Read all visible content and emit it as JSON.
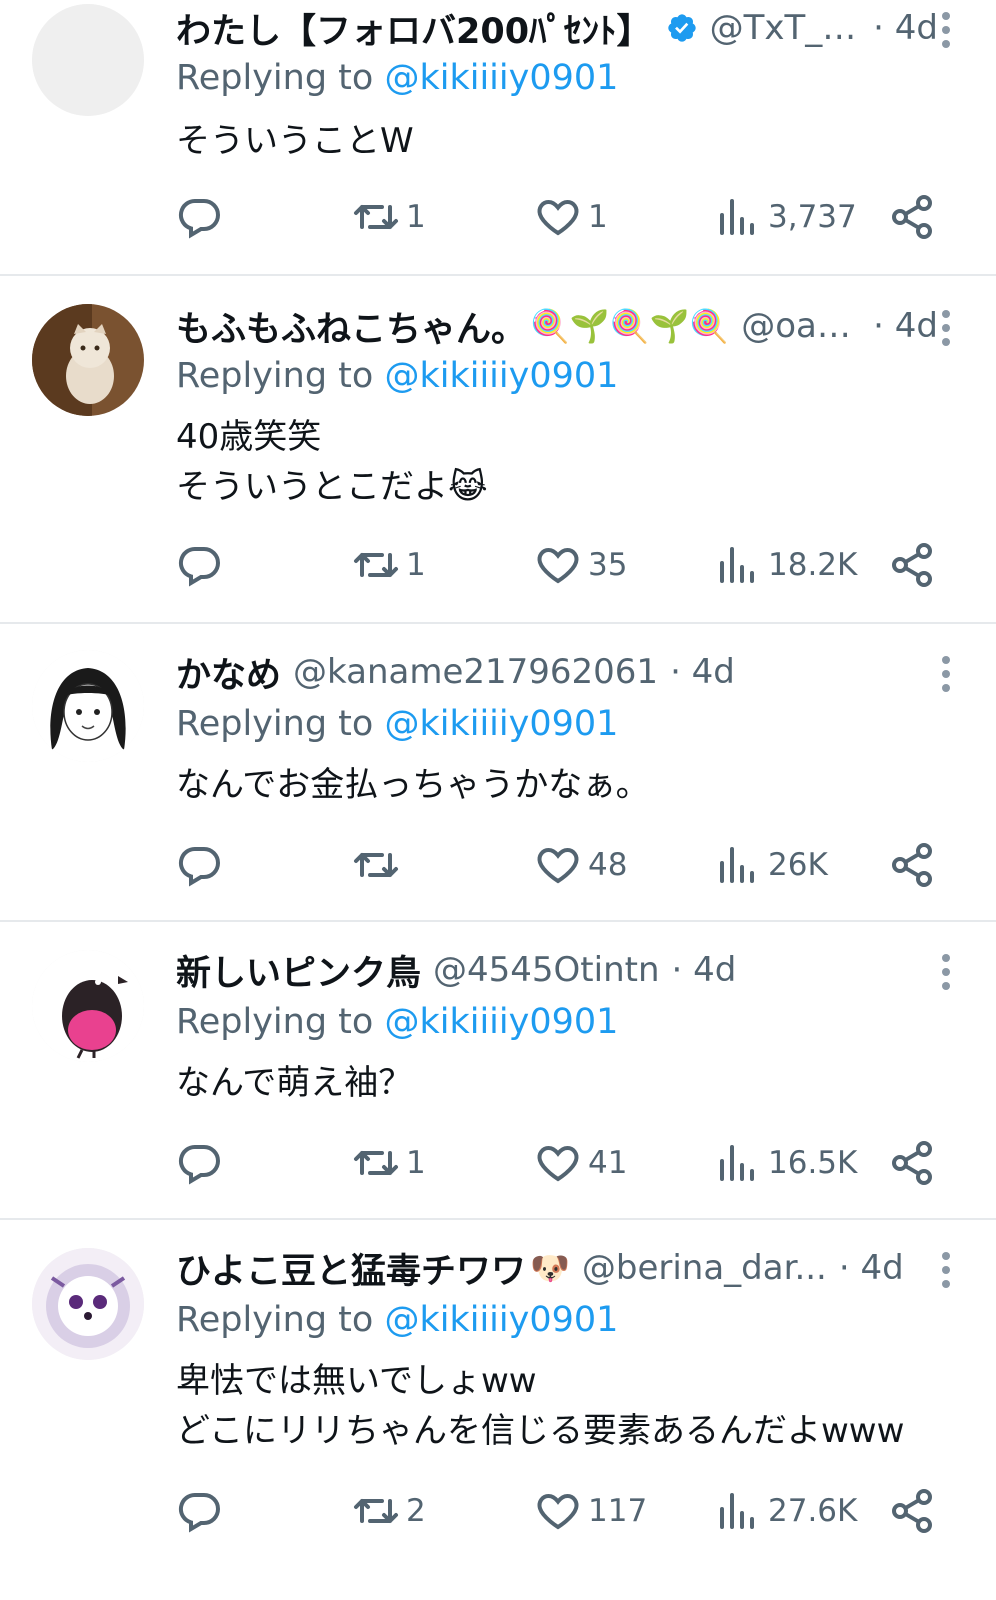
{
  "replying_label": "Replying to",
  "tweets": [
    {
      "name": "わたし【フォロバ200ﾊﾟｾﾝﾄ】",
      "handle": "@TxT_o...",
      "time": "· 4d",
      "verified": true,
      "reply_to": "@kikiiiiy0901",
      "text": "そういうことW",
      "retweets": "1",
      "likes": "1",
      "views": "3,737",
      "avatar": "blank"
    },
    {
      "name": "もふもふねこちゃん。",
      "name_emoji": "🍭🌱🍭🌱🍭",
      "handle": "@oasis_l...",
      "time": "· 4d",
      "reply_to": "@kikiiiiy0901",
      "text": "40歳笑笑\nそういうとこだよ😹",
      "retweets": "1",
      "likes": "35",
      "views": "18.2K",
      "avatar": "cat"
    },
    {
      "name": "かなめ",
      "handle": "@kaname217962061",
      "time": "· 4d",
      "reply_to": "@kikiiiiy0901",
      "text": "なんでお金払っちゃうかなぁ。",
      "retweets": "",
      "likes": "48",
      "views": "26K",
      "avatar": "girl"
    },
    {
      "name": "新しいピンク鳥",
      "handle": "@4545Otintn",
      "time": "· 4d",
      "reply_to": "@kikiiiiy0901",
      "text": "なんで萌え袖？",
      "retweets": "1",
      "likes": "41",
      "views": "16.5K",
      "avatar": "bird"
    },
    {
      "name": "ひよこ豆と猛毒チワワ",
      "name_emoji": "🐶",
      "handle": "@berina_dar...",
      "time": "· 4d",
      "reply_to": "@kikiiiiy0901",
      "text": "卑怯では無いでしょww\nどこにリリちゃんを信じる要素あるんだよwww",
      "retweets": "2",
      "likes": "117",
      "views": "27.6K",
      "avatar": "dog"
    }
  ],
  "colors": {
    "text": "#0f1419",
    "secondary": "#536471",
    "mention": "#1d9bf0",
    "divider": "#e6e9ec",
    "verified": "#1d9bf0"
  },
  "icons": [
    "reply-icon",
    "retweet-icon",
    "like-icon",
    "views-icon",
    "share-icon",
    "more-icon",
    "verified-badge-icon"
  ]
}
